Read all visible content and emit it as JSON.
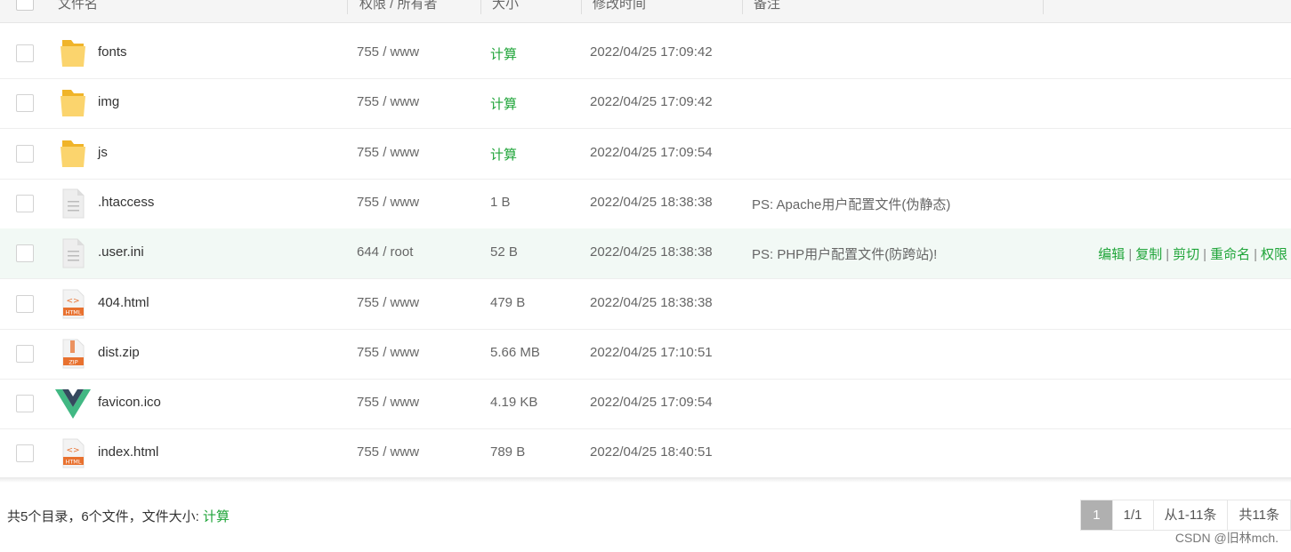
{
  "header": {
    "col_name": "文件名",
    "col_perm": "权限 / 所有者",
    "col_size": "大小",
    "col_time": "修改时间",
    "col_note": "备注"
  },
  "rows": [
    {
      "name": "fonts",
      "type": "folder",
      "perm": "755 / www",
      "size": "计算",
      "time": "2022/04/25 17:09:42",
      "note": ""
    },
    {
      "name": "img",
      "type": "folder",
      "perm": "755 / www",
      "size": "计算",
      "time": "2022/04/25 17:09:42",
      "note": ""
    },
    {
      "name": "js",
      "type": "folder",
      "perm": "755 / www",
      "size": "计算",
      "time": "2022/04/25 17:09:54",
      "note": ""
    },
    {
      "name": ".htaccess",
      "type": "file",
      "perm": "755 / www",
      "size": "1 B",
      "time": "2022/04/25 18:38:38",
      "note": "PS: Apache用户配置文件(伪静态)"
    },
    {
      "name": ".user.ini",
      "type": "file",
      "perm": "644 / root",
      "size": "52 B",
      "time": "2022/04/25 18:38:38",
      "note": "PS: PHP用户配置文件(防跨站)!"
    },
    {
      "name": "404.html",
      "type": "html",
      "perm": "755 / www",
      "size": "479 B",
      "time": "2022/04/25 18:38:38",
      "note": ""
    },
    {
      "name": "dist.zip",
      "type": "zip",
      "perm": "755 / www",
      "size": "5.66 MB",
      "time": "2022/04/25 17:10:51",
      "note": ""
    },
    {
      "name": "favicon.ico",
      "type": "vue",
      "perm": "755 / www",
      "size": "4.19 KB",
      "time": "2022/04/25 17:09:54",
      "note": ""
    },
    {
      "name": "index.html",
      "type": "html",
      "perm": "755 / www",
      "size": "789 B",
      "time": "2022/04/25 18:40:51",
      "note": ""
    }
  ],
  "row_actions": {
    "edit": "编辑",
    "copy": "复制",
    "cut": "剪切",
    "rename": "重命名",
    "perm": "权限",
    "separator": "|"
  },
  "icon_labels": {
    "html": "HTML",
    "zip": "ZIP"
  },
  "footer": {
    "summary": "共5个目录，6个文件，文件大小:",
    "calc": "计算"
  },
  "pager": {
    "current": "1",
    "pages": "1/1",
    "range": "从1-11条",
    "total": "共11条"
  },
  "watermark": "CSDN @旧林mch.",
  "colors": {
    "accent": "#20a53a",
    "hover_row": "#f2f9f5",
    "folder": "#f5c344"
  }
}
